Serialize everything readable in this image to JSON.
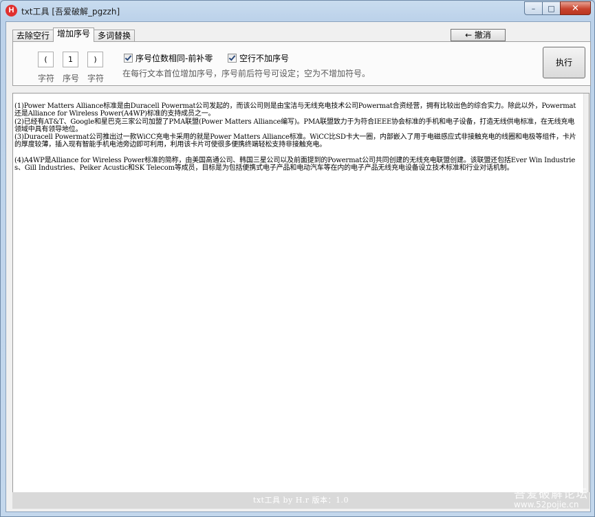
{
  "window": {
    "title": "txt工具 [吾爱破解_pgzzh]",
    "icon": "app-h-icon"
  },
  "titlebar_buttons": {
    "minimize": "minimize-icon",
    "maximize": "maximize-icon",
    "close": "close-icon"
  },
  "tabs": [
    {
      "label": "去除空行",
      "active": false
    },
    {
      "label": "增加序号",
      "active": true
    },
    {
      "label": "多词替换",
      "active": false
    }
  ],
  "undo": {
    "icon": "arrow-left-icon",
    "label": "← 撤消"
  },
  "numbering": {
    "prefix_value": "(",
    "prefix_label": "字符",
    "start_value": "1",
    "start_label": "序号",
    "suffix_value": ")",
    "suffix_label": "字符"
  },
  "options": {
    "same_digits": {
      "label": "序号位数相同-前补零",
      "checked": true
    },
    "skip_empty": {
      "label": "空行不加序号",
      "checked": true
    }
  },
  "hint": "在每行文本首位增加序号，序号前后符号可设定；空为不增加符号。",
  "execute_label": "执行",
  "editor_lines": [
    "(1)Power Matters Alliance标准是由Duracell Powermat公司发起的，而该公司则是由宝洁与无线充电技术公司Powermat合资经营，拥有比较出色的综合实力。除此以外，Powermat还是Alliance for Wireless Power(A4WP)标准的支持成员之一。",
    "(2)已经有AT&T、Google和星巴克三家公司加盟了PMA联盟(Power Matters Alliance编写)。PMA联盟致力于为符合IEEE协会标准的手机和电子设备，打造无线供电标准，在无线充电领域中具有领导地位。",
    "(3)Duracell Powermat公司推出过一款WiCC充电卡采用的就是Power Matters Alliance标准。WiCC比SD卡大一圈，内部嵌入了用于电磁感应式非接触充电的线圈和电极等组件，卡片的厚度较薄，插入现有智能手机电池旁边即可利用，利用该卡片可使很多便携终端轻松支持非接触充电。",
    "",
    "(4)A4WP是Alliance for Wireless Power标准的简称，由美国高通公司、韩国三星公司以及前面提到的Powermat公司共同创建的无线充电联盟创建。该联盟还包括Ever Win Industries、Gill Industries、Peiker Acustic和SK Telecom等成员，目标是为包括便携式电子产品和电动汽车等在内的电子产品无线充电设备设立技术标准和行业对话机制。"
  ],
  "status": "txt工具 by H.r  版本：1.0",
  "watermark": {
    "cn": "吾爱破解论坛",
    "url": "www.52pojie.cn"
  }
}
